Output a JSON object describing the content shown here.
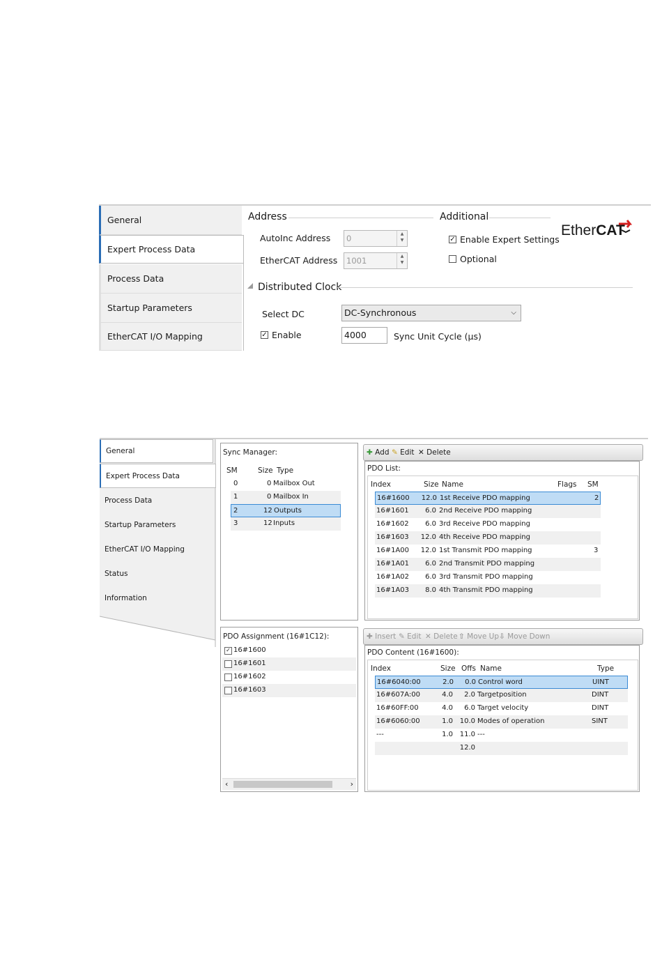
{
  "top": {
    "tabs": [
      "General",
      "Expert Process Data",
      "Process Data",
      "Startup Parameters",
      "EtherCAT I/O Mapping"
    ],
    "address_heading": "Address",
    "additional_heading": "Additional",
    "autoinc_label": "AutoInc Address",
    "autoinc_value": "0",
    "ethercat_address_label": "EtherCAT Address",
    "ethercat_address_value": "1001",
    "enable_expert_label": "Enable Expert Settings",
    "enable_expert_checked": true,
    "optional_label": "Optional",
    "optional_checked": false,
    "logo_text_ether": "Ether",
    "logo_text_cat": "CAT",
    "dc_heading": "Distributed Clock",
    "select_dc_label": "Select DC",
    "select_dc_value": "DC-Synchronous",
    "enable_label": "Enable",
    "enable_checked": true,
    "cycle_value": "4000",
    "cycle_label": "Sync Unit Cycle (µs)"
  },
  "bottom": {
    "tabs": [
      "General",
      "Expert Process Data",
      "Process Data",
      "Startup Parameters",
      "EtherCAT I/O Mapping",
      "Status",
      "Information"
    ],
    "sync_manager": {
      "title": "Sync Manager:",
      "headers": [
        "SM",
        "Size",
        "Type"
      ],
      "rows": [
        {
          "sm": "0",
          "size": "0",
          "type": "Mailbox Out"
        },
        {
          "sm": "1",
          "size": "0",
          "type": "Mailbox In"
        },
        {
          "sm": "2",
          "size": "12",
          "type": "Outputs"
        },
        {
          "sm": "3",
          "size": "12",
          "type": "Inputs"
        }
      ]
    },
    "pdo_toolbar": {
      "add": "Add",
      "edit": "Edit",
      "delete": "Delete"
    },
    "pdo_list": {
      "title": "PDO List:",
      "headers": [
        "Index",
        "Size",
        "Name",
        "Flags",
        "SM"
      ],
      "rows": [
        {
          "index": "16#1600",
          "size": "12.0",
          "name": "1st Receive PDO mapping",
          "flags": "",
          "sm": "2"
        },
        {
          "index": "16#1601",
          "size": "6.0",
          "name": "2nd Receive PDO mapping",
          "flags": "",
          "sm": ""
        },
        {
          "index": "16#1602",
          "size": "6.0",
          "name": "3rd Receive PDO mapping",
          "flags": "",
          "sm": ""
        },
        {
          "index": "16#1603",
          "size": "12.0",
          "name": "4th Receive PDO mapping",
          "flags": "",
          "sm": ""
        },
        {
          "index": "16#1A00",
          "size": "12.0",
          "name": "1st Transmit PDO mapping",
          "flags": "",
          "sm": "3"
        },
        {
          "index": "16#1A01",
          "size": "6.0",
          "name": "2nd Transmit PDO mapping",
          "flags": "",
          "sm": ""
        },
        {
          "index": "16#1A02",
          "size": "6.0",
          "name": "3rd Transmit PDO mapping",
          "flags": "",
          "sm": ""
        },
        {
          "index": "16#1A03",
          "size": "8.0",
          "name": "4th Transmit PDO mapping",
          "flags": "",
          "sm": ""
        }
      ]
    },
    "pdo_assignment": {
      "title": "PDO Assignment (16#1C12):",
      "rows": [
        {
          "label": "16#1600",
          "checked": true
        },
        {
          "label": "16#1601",
          "checked": false
        },
        {
          "label": "16#1602",
          "checked": false
        },
        {
          "label": "16#1603",
          "checked": false
        }
      ]
    },
    "content_toolbar": {
      "insert": "Insert",
      "edit": "Edit",
      "delete": "Delete",
      "move_up": "Move Up",
      "move_down": "Move Down"
    },
    "pdo_content": {
      "title": "PDO Content (16#1600):",
      "headers": [
        "Index",
        "Size",
        "Offs",
        "Name",
        "Type"
      ],
      "rows": [
        {
          "index": "16#6040:00",
          "size": "2.0",
          "offs": "0.0",
          "name": "Control word",
          "type": "UINT"
        },
        {
          "index": "16#607A:00",
          "size": "4.0",
          "offs": "2.0",
          "name": "Targetposition",
          "type": "DINT"
        },
        {
          "index": "16#60FF:00",
          "size": "4.0",
          "offs": "6.0",
          "name": "Target velocity",
          "type": "DINT"
        },
        {
          "index": "16#6060:00",
          "size": "1.0",
          "offs": "10.0",
          "name": "Modes of operation",
          "type": "SINT"
        },
        {
          "index": "---",
          "size": "1.0",
          "offs": "11.0",
          "name": "---",
          "type": ""
        },
        {
          "index": "",
          "size": "",
          "offs": "12.0",
          "name": "",
          "type": ""
        }
      ]
    }
  }
}
